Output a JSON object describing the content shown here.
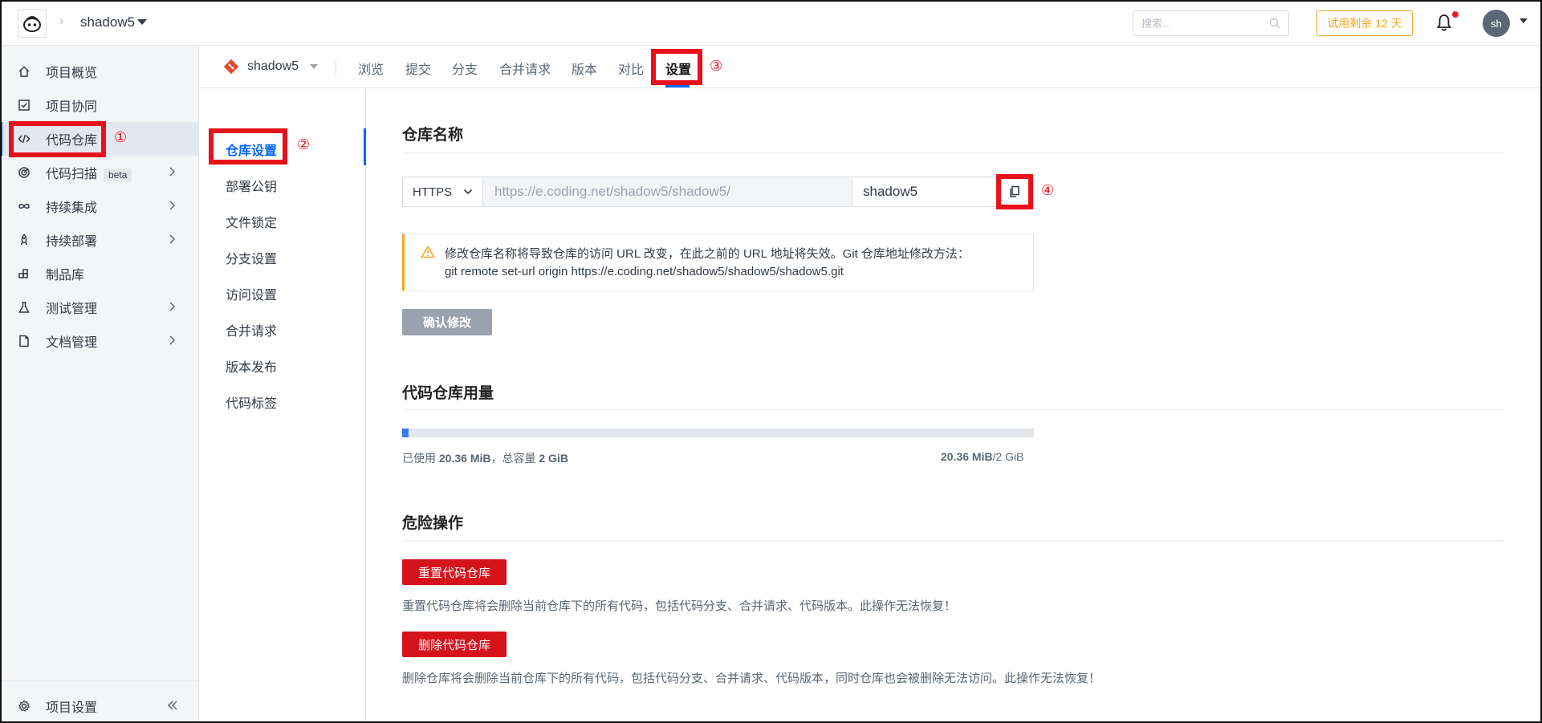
{
  "topbar": {
    "project_name": "shadow5",
    "search_placeholder": "搜索...",
    "trial_label": "试用剩余 12 天",
    "avatar_initials": "sh"
  },
  "sidebar": {
    "items": [
      {
        "label": "项目概览",
        "icon": "home-icon"
      },
      {
        "label": "项目协同",
        "icon": "checkbox-icon"
      },
      {
        "label": "代码仓库",
        "icon": "code-icon",
        "active": true
      },
      {
        "label": "代码扫描",
        "icon": "scan-icon",
        "badge": "beta",
        "expandable": true
      },
      {
        "label": "持续集成",
        "icon": "infinity-icon",
        "expandable": true
      },
      {
        "label": "持续部署",
        "icon": "rocket-icon",
        "expandable": true
      },
      {
        "label": "制品库",
        "icon": "package-icon"
      },
      {
        "label": "测试管理",
        "icon": "flask-icon",
        "expandable": true
      },
      {
        "label": "文档管理",
        "icon": "document-icon",
        "expandable": true
      }
    ],
    "bottom_label": "项目设置"
  },
  "repo_header": {
    "repo_name": "shadow5",
    "tabs": [
      "浏览",
      "提交",
      "分支",
      "合并请求",
      "版本",
      "对比",
      "设置"
    ],
    "active_tab": "设置"
  },
  "settings_nav": {
    "items": [
      "仓库设置",
      "部署公钥",
      "文件锁定",
      "分支设置",
      "访问设置",
      "合并请求",
      "版本发布",
      "代码标签"
    ],
    "active": "仓库设置"
  },
  "repo_name_section": {
    "title": "仓库名称",
    "protocol": "HTTPS",
    "url_prefix": "https://e.coding.net/shadow5/shadow5/",
    "name_value": "shadow5",
    "warning_line1": "修改仓库名称将导致仓库的访问 URL 改变，在此之前的 URL 地址将失效。Git 仓库地址修改方法：",
    "warning_line2": "git remote set-url origin https://e.coding.net/shadow5/shadow5/shadow5.git",
    "confirm_label": "确认修改"
  },
  "usage_section": {
    "title": "代码仓库用量",
    "used_fraction": 0.0099,
    "left_prefix": "已使用 ",
    "used": "20.36 MiB",
    "left_mid": "，总容量 ",
    "total": "2 GiB",
    "right_used": "20.36 MiB",
    "right_total": "/2 GiB"
  },
  "danger_section": {
    "title": "危险操作",
    "reset_label": "重置代码仓库",
    "reset_desc": "重置代码仓库将会删除当前仓库下的所有代码，包括代码分支、合并请求、代码版本。此操作无法恢复！",
    "delete_label": "删除代码仓库",
    "delete_desc": "删除仓库将会删除当前仓库下的所有代码，包括代码分支、合并请求、代码版本，同时仓库也会被删除无法访问。此操作无法恢复！"
  },
  "annotations": [
    "①",
    "②",
    "③",
    "④"
  ],
  "colors": {
    "accent": "#0066ff",
    "annotation_red": "#e8101a",
    "danger": "#d5131d",
    "warning": "#f5a623"
  }
}
